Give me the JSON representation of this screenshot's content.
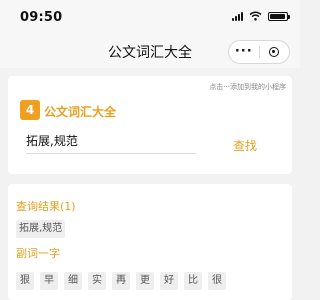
{
  "status_bar": {
    "time": "09:50"
  },
  "nav": {
    "title": "公文词汇大全",
    "more_icon": "more-dots-icon",
    "close_icon": "target-close-icon"
  },
  "hint": "点击···添加到我的小程序",
  "brand": {
    "logo_text": "4",
    "name": "公文词汇大全"
  },
  "search": {
    "value": "拓展,规范",
    "button": "查找"
  },
  "results": {
    "title": "查询结果(1)",
    "items": [
      "拓展,规范"
    ]
  },
  "adverb": {
    "title": "副词一字",
    "chars": [
      "狠",
      "早",
      "细",
      "实",
      "再",
      "更",
      "好",
      "比",
      "很"
    ]
  },
  "colors": {
    "accent": "#e8a020",
    "background": "#f2f2f2"
  }
}
